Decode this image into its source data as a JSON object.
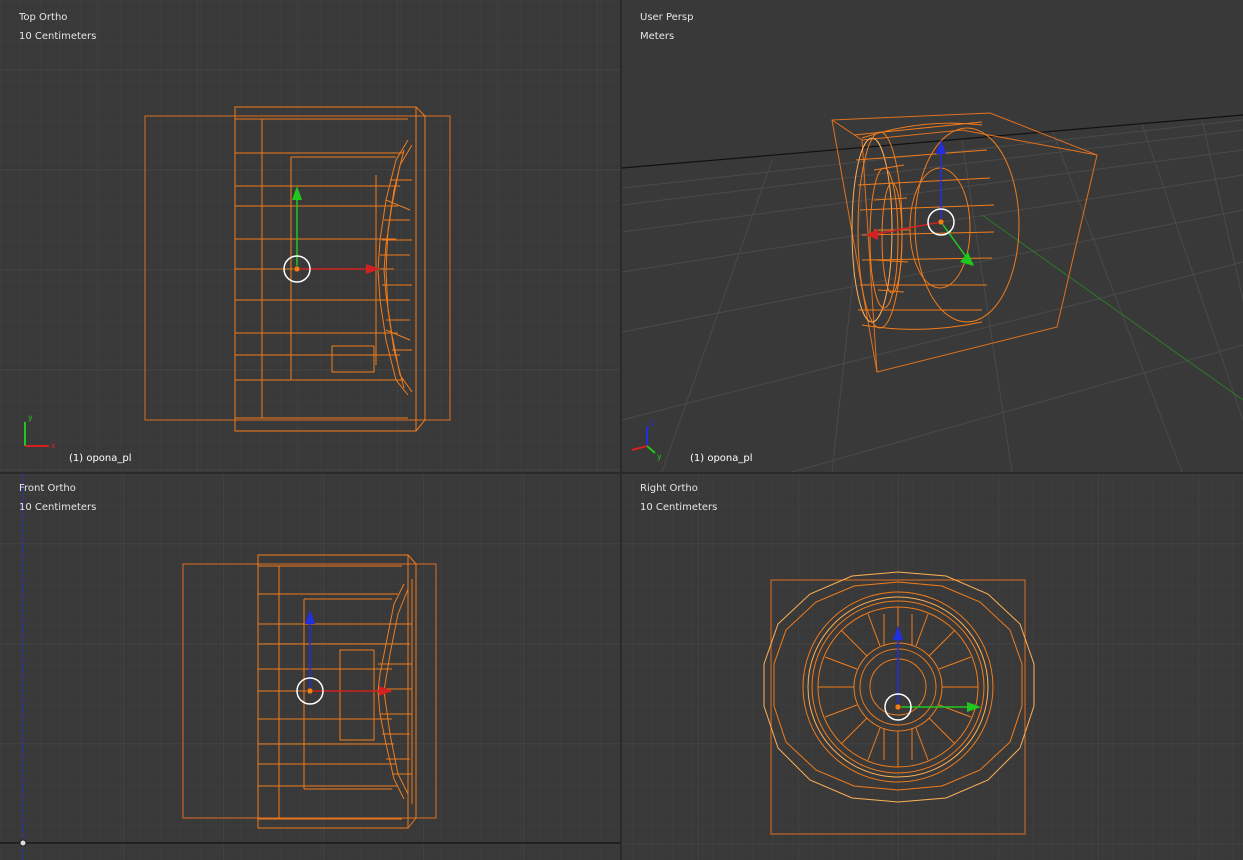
{
  "viewports": {
    "top_left": {
      "view_name": "Top Ortho",
      "grid_scale": "10 Centimeters",
      "object_label": "(1) opona_pl"
    },
    "top_right": {
      "view_name": "User Persp",
      "grid_scale": "Meters",
      "object_label": "(1) opona_pl"
    },
    "bottom_left": {
      "view_name": "Front Ortho",
      "grid_scale": "10 Centimeters"
    },
    "bottom_right": {
      "view_name": "Right Ortho",
      "grid_scale": "10 Centimeters"
    }
  },
  "axis_widget_letters": {
    "x": "x",
    "y": "y",
    "z": "z"
  },
  "colors": {
    "viewport_bg": "#393939",
    "grid_minor": "#404040",
    "grid_major": "#454545",
    "wireframe": "#f07c1c",
    "wireframe_light": "#ffb055",
    "bounds": "#e07020",
    "gizmo_x": "#d42020",
    "gizmo_y": "#1ec81e",
    "gizmo_z": "#2030e0"
  },
  "icons": [
    "transform-gizmo-icon",
    "object-origin-icon",
    "axis-widget-icon"
  ]
}
